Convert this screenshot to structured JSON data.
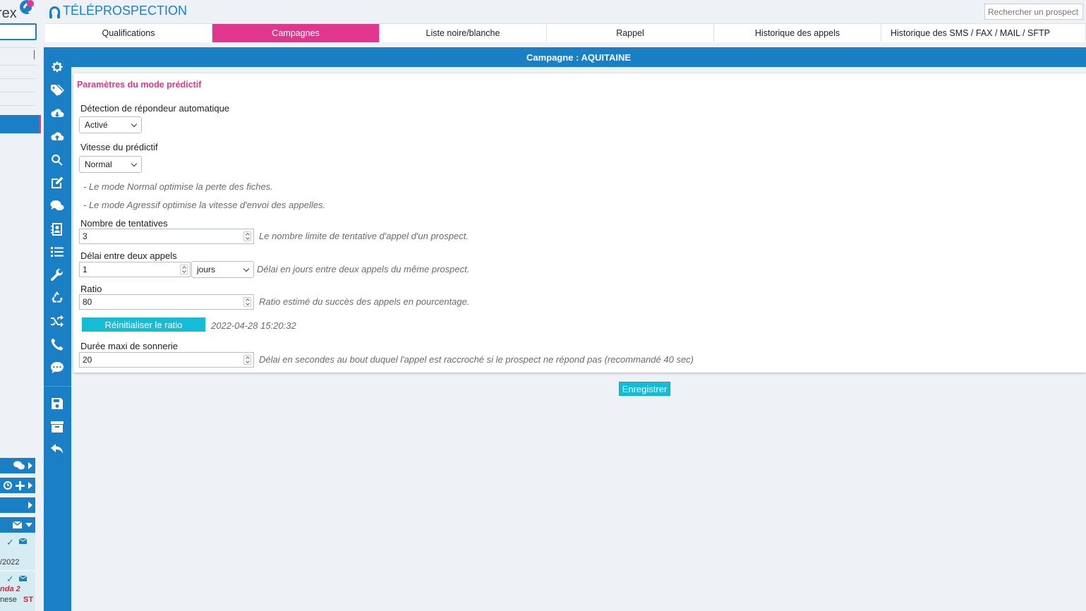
{
  "app": {
    "logo_text": "rex",
    "title": "TÉLÉPROSPECTION",
    "search_placeholder": "Rechercher un prospect"
  },
  "tabs": [
    {
      "label": "Qualifications",
      "active": false
    },
    {
      "label": "Campagnes",
      "active": true
    },
    {
      "label": "Liste noire/blanche",
      "active": false
    },
    {
      "label": "Rappel",
      "active": false
    },
    {
      "label": "Historique des appels",
      "active": false
    },
    {
      "label": "Historique des SMS / FAX / MAIL / SFTP",
      "active": false
    }
  ],
  "campaign": {
    "header": "Campagne : AQUITAINE",
    "section_title": "Paramètres du mode prédictif",
    "fields": {
      "detection_label": "Détection de répondeur automatique",
      "detection_value": "Activé",
      "speed_label": "Vitesse du prédictif",
      "speed_value": "Normal",
      "speed_note_1": "- Le mode Normal optimise la perte des fiches.",
      "speed_note_2": "- Le mode Agressif optimise la vitesse d'envoi des appelles.",
      "attempts_label": "Nombre de tentatives",
      "attempts_value": "3",
      "attempts_hint": "Le nombre limite de tentative d'appel d'un prospect.",
      "delay_label": "Délai entre deux appels",
      "delay_value": "1",
      "delay_unit": "jours",
      "delay_hint": "Délai en jours entre deux appels du même prospect.",
      "ratio_label": "Ratio",
      "ratio_value": "80",
      "ratio_hint": "Ratio estimé du succès des appels en pourcentage.",
      "reset_button": "Réinitialiser le ratio",
      "reset_timestamp": "2022-04-28 15:20:32",
      "ring_label": "Durée maxi de sonnerie",
      "ring_value": "20",
      "ring_hint": "Délai en secondes au bout duquel l'appel est raccroché si le prospect ne répond pas (recommandé 40 sec)"
    },
    "save_button": "Enregistrer"
  },
  "left_panel": {
    "note_date": "/2022",
    "note_agenda": "nda 2",
    "note_name": "nese",
    "note_tag": "ST"
  },
  "colors": {
    "brand_blue": "#1a7fc4",
    "accent_pink": "#e0368e",
    "button_cyan": "#16bcd6",
    "background": "#eef1f6"
  },
  "icons": [
    "gear-icon",
    "tags-icon",
    "cloud-download-icon",
    "cloud-upload-icon",
    "search-icon",
    "edit-icon",
    "comments-icon",
    "contact-card-icon",
    "list-icon",
    "wrench-icon",
    "recycle-icon",
    "shuffle-icon",
    "phone-icon",
    "sms-icon",
    "save-icon",
    "archive-icon",
    "undo-icon"
  ]
}
